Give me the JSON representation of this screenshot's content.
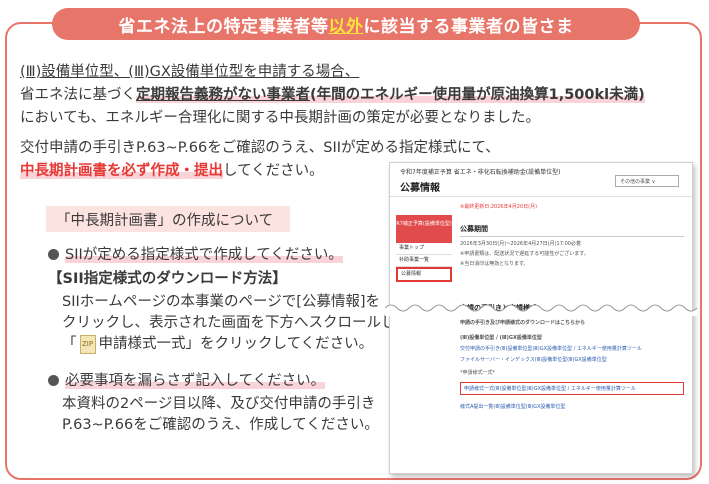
{
  "banner": {
    "pre": "省エネ法上の特定事業者等",
    "hl": "以外",
    "post": "に該当する事業者の皆さま"
  },
  "line1": "(Ⅲ)設備単位型、(Ⅲ)GX設備単位型を申請する場合、",
  "line2": {
    "a": "省エネ法に基づく",
    "b": "定期報告義務がない事業者",
    "c": "(年間のエネルギー使用量が原油換算1,500kl未満)"
  },
  "line3": "においても、エネルギー合理化に関する中長期計画の策定が必要となりました。",
  "line4": "交付申請の手引きP.63~P.66をご確認のうえ、SIIが定める指定様式にて、",
  "line5": {
    "red": "中長期計画書を必ず作成・提出",
    "rest": "してください。"
  },
  "subhead": "「中長期計画書」の作成について",
  "bullet1": "SIIが定める指定様式で作成してください。",
  "dl_head": "【SII指定様式のダウンロード方法】",
  "dl1": "SIIホームページの本事業のページで[公募情報]を",
  "dl2": "クリックし、表示された画面を下方へスクロールして",
  "dl3": {
    "a": "「",
    "icon": "ZIP",
    "b": "申請様式一式」をクリックしてください。"
  },
  "bullet2": "必要事項を漏らさず記入してください。",
  "note1": "本資料の2ページ目以降、及び交付申請の手引き",
  "note2": "P.63~P.66をご確認のうえ、作成してください。",
  "shot": {
    "top": "令和7年度補正予算 省エネ・非化石転換補助金(設備単位型)",
    "title": "公募情報",
    "search": "その他の事業 ∨",
    "side_head": "R7補正予算(設備単位型)",
    "side_items": [
      "事業トップ",
      "补助事業一覧",
      "公募情報"
    ],
    "date_note": "※最終更新日:2026年4月20日(月)",
    "sec1": "公募期間",
    "sec1_line": "2026年3月30日(月)~2026年4月27日(月)17:00必着",
    "small1": "※申請書類は、配送状況で遅延する可能性がございます。",
    "small2": "※当日消印は無効となります。",
    "lower_head": "申請の手引きと申請様式",
    "lower_line": "申請の手引き及び申請様式のダウンロードはこちらから",
    "lower_sub": "(Ⅲ)設備単位型 / (Ⅲ)GX設備単位型",
    "link1": "交付申請の手引き(Ⅲ)設備単位型(Ⅲ)GX設備単位型 / エネルギー使用量計算ツール",
    "link2": "ファイルサーバー・インデックス(Ⅲ)設備単位型(Ⅲ)GX設備単位型",
    "lower_note": "*申請様式一式*",
    "link3": "申請様式一式(Ⅲ)設備単位型(Ⅲ)GX設備単位型 / エネルギー使用量計算ツール",
    "link4": "様式A提出一覧(Ⅲ)設備単位型(Ⅲ)GX設備単位型"
  },
  "colors": {
    "accent": "#e8756a",
    "highlight": "#ffe23a",
    "red": "#e53935"
  }
}
